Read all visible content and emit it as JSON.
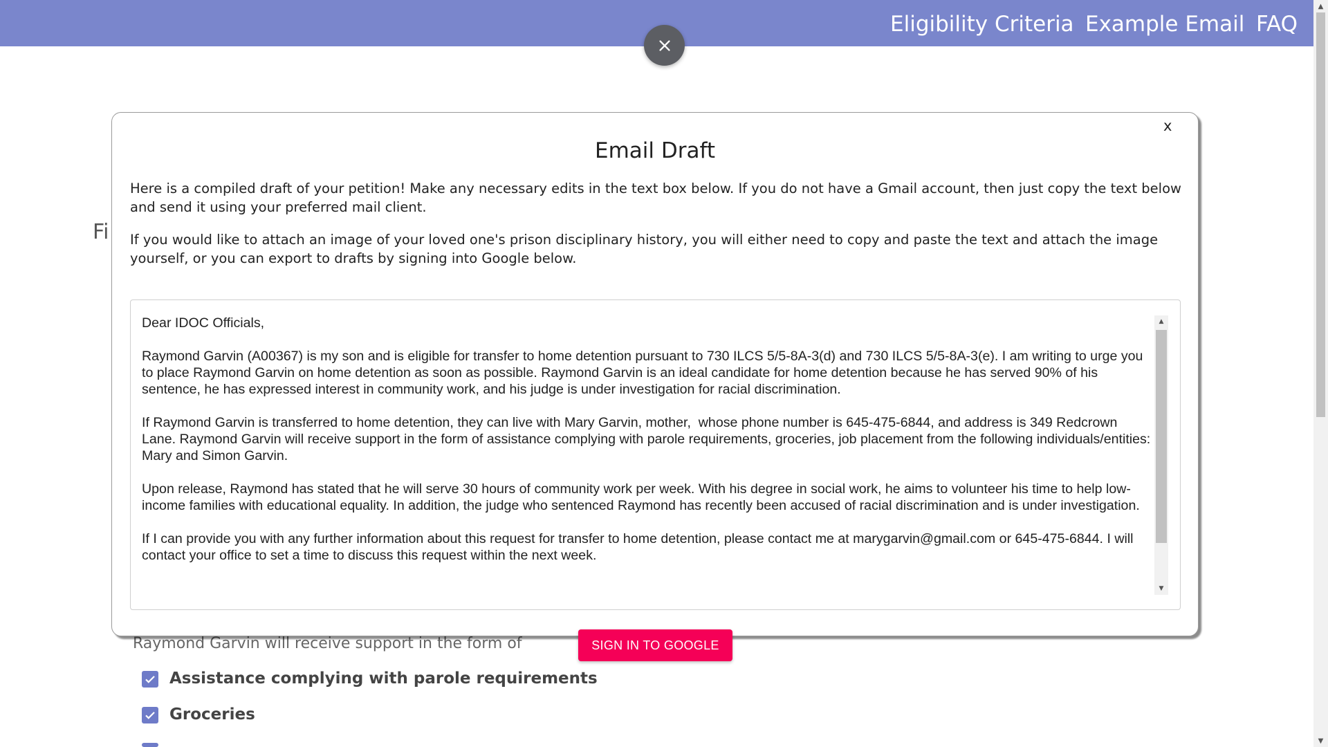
{
  "nav": {
    "links": [
      "Eligibility Criteria",
      "Example Email",
      "FAQ"
    ]
  },
  "icons": {
    "fab_close": "close-icon",
    "checkbox": "check-icon"
  },
  "colors": {
    "nav_bg": "#7a86cc",
    "primary_button": "#f50057",
    "checkbox": "#6e7bc8"
  },
  "background": {
    "heading_fragment": "Fi",
    "support_text": "Raymond Garvin will receive support in the form of",
    "checkboxes": [
      {
        "label": "Assistance complying with parole requirements",
        "checked": true
      },
      {
        "label": "Groceries",
        "checked": true
      }
    ]
  },
  "modal": {
    "close_label": "x",
    "title": "Email Draft",
    "paragraph1": "Here is a compiled draft of your petition! Make any necessary edits in the text box below. If you do not have a Gmail account, then just copy the text below and send it using your preferred mail client.",
    "paragraph2": "If you would like to attach an image of your loved one's prison disciplinary history, you will either need to copy and paste the text and attach the image yourself, or you can export to drafts by signing into Google below.",
    "email_body": "Dear IDOC Officials,\n\nRaymond Garvin (A00367) is my son and is eligible for transfer to home detention pursuant to 730 ILCS 5/5-8A-3(d) and 730 ILCS 5/5-8A-3(e). I am writing to urge you to place Raymond Garvin on home detention as soon as possible. Raymond Garvin is an ideal candidate for home detention because he has served 90% of his sentence, he has expressed interest in community work, and his judge is under investigation for racial discrimination.\n\nIf Raymond Garvin is transferred to home detention, they can live with Mary Garvin, mother,  whose phone number is 645-475-6844, and address is 349 Redcrown Lane. Raymond Garvin will receive support in the form of assistance complying with parole requirements, groceries, job placement from the following individuals/entities: Mary and Simon Garvin.\n\nUpon release, Raymond has stated that he will serve 30 hours of community work per week. With his degree in social work, he aims to volunteer his time to help low-income families with educational equality. In addition, the judge who sentenced Raymond has recently been accused of racial discrimination and is under investigation.\n\nIf I can provide you with any further information about this request for transfer to home detention, please contact me at marygarvin@gmail.com or 645-475-6844. I will contact your office to set a time to discuss this request within the next week.",
    "google_button": "SIGN IN TO GOOGLE"
  }
}
